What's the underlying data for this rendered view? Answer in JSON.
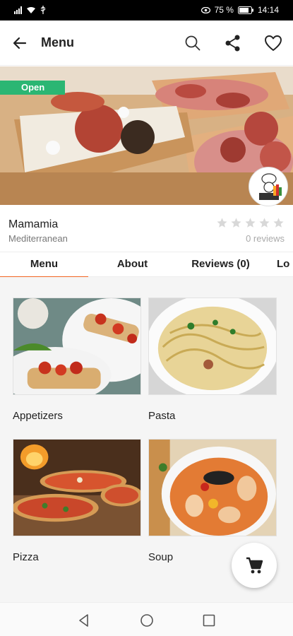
{
  "status_bar": {
    "battery_percent": "75 %",
    "time": "14:14"
  },
  "app_bar": {
    "title": "Menu",
    "icons": [
      "back-arrow-icon",
      "search-icon",
      "share-icon",
      "heart-icon"
    ]
  },
  "restaurant": {
    "status_badge": "Open",
    "name": "Mamamia",
    "cuisine": "Mediterranean",
    "rating_stars": 0,
    "rating_max": 5,
    "reviews_text": "0 reviews"
  },
  "tabs": [
    {
      "label": "Menu",
      "active": true
    },
    {
      "label": "About",
      "active": false
    },
    {
      "label": "Reviews (0)",
      "active": false
    },
    {
      "label": "Lo",
      "active": false
    }
  ],
  "categories": [
    {
      "label": "Appetizers"
    },
    {
      "label": "Pasta"
    },
    {
      "label": "Pizza"
    },
    {
      "label": "Soup"
    }
  ],
  "fab": {
    "icon": "cart-icon"
  },
  "colors": {
    "accent": "#f26522",
    "open_badge": "#2bb673"
  }
}
